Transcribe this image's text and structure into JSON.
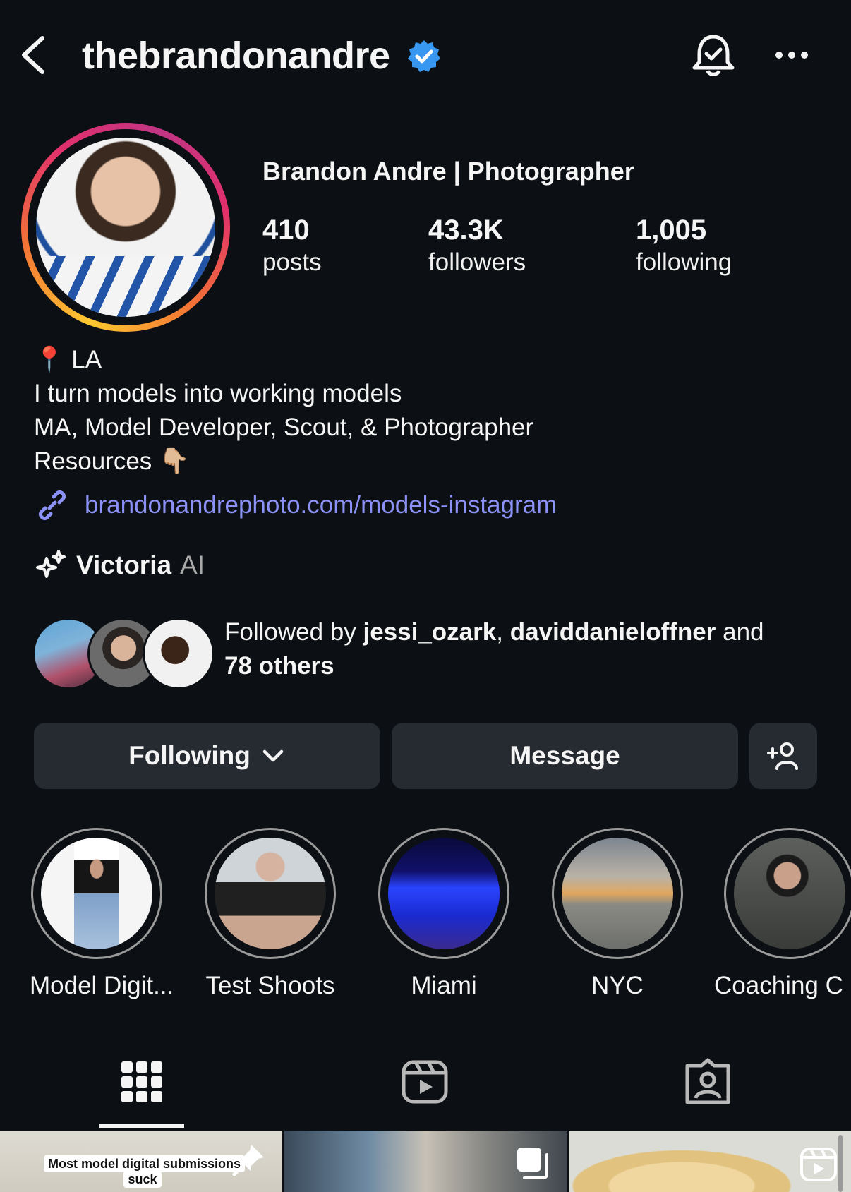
{
  "header": {
    "username": "thebrandonandre",
    "verified": true
  },
  "profile": {
    "full_name": "Brandon Andre | Photographer",
    "stats": [
      {
        "value": "410",
        "label": "posts"
      },
      {
        "value": "43.3K",
        "label": "followers"
      },
      {
        "value": "1,005",
        "label": "following"
      }
    ],
    "bio": [
      "📍 LA",
      "I turn models into working models",
      "MA, Model Developer, Scout, & Photographer",
      "Resources 👇🏼"
    ],
    "link": "brandonandrephoto.com/models-instagram",
    "ai_name": "Victoria",
    "ai_label": "AI"
  },
  "followed_by": {
    "prefix": "Followed by ",
    "user1": "jessi_ozark",
    "sep": ", ",
    "user2": "daviddanieloffner",
    "and": " and",
    "others": "78 others"
  },
  "buttons": {
    "following": "Following",
    "message": "Message"
  },
  "highlights": [
    {
      "label": "Model Digit..."
    },
    {
      "label": "Test Shoots"
    },
    {
      "label": "Miami"
    },
    {
      "label": "NYC"
    },
    {
      "label": "Coaching C"
    }
  ],
  "grid": {
    "post1_caption": "Most model digital submissions suck"
  },
  "colors": {
    "background": "#0c1014",
    "button": "#262a31",
    "link": "#8c91f7",
    "verified": "#3897f0"
  }
}
